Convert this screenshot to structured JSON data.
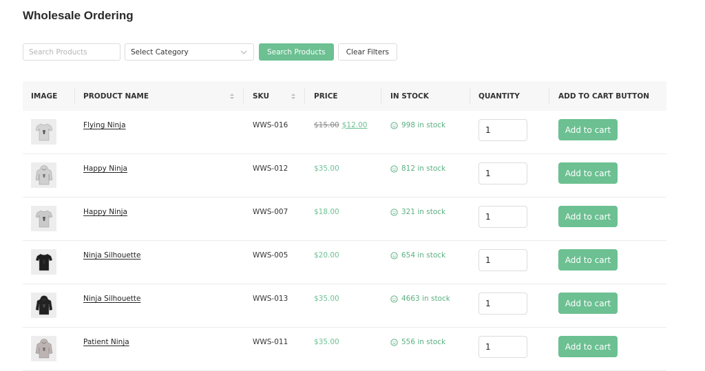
{
  "page": {
    "title": "Wholesale Ordering"
  },
  "filters": {
    "search_placeholder": "Search Products",
    "category_selected": "Select Category",
    "search_button": "Search Products",
    "clear_button": "Clear Filters"
  },
  "table": {
    "headers": {
      "image": "IMAGE",
      "product_name": "PRODUCT NAME",
      "sku": "SKU",
      "price": "PRICE",
      "in_stock": "IN STOCK",
      "quantity": "QUANTITY",
      "add_to_cart": "ADD TO CART BUTTON"
    },
    "rows": [
      {
        "name": "Flying Ninja",
        "sku": "WWS-016",
        "price_old": "$15.00",
        "price": "$12.00",
        "stock": "998 in stock",
        "qty": "1",
        "button": "Add to cart",
        "image_icon": "tshirt-icon",
        "shirt_color": "#d4d4d4"
      },
      {
        "name": "Happy Ninja",
        "sku": "WWS-012",
        "price_old": "",
        "price": "$35.00",
        "stock": "812 in stock",
        "qty": "1",
        "button": "Add to cart",
        "image_icon": "hoodie-icon",
        "shirt_color": "#cfcfcf"
      },
      {
        "name": "Happy Ninja",
        "sku": "WWS-007",
        "price_old": "",
        "price": "$18.00",
        "stock": "321 in stock",
        "qty": "1",
        "button": "Add to cart",
        "image_icon": "tshirt-icon",
        "shirt_color": "#c9c9c9"
      },
      {
        "name": "Ninja Silhouette",
        "sku": "WWS-005",
        "price_old": "",
        "price": "$20.00",
        "stock": "654 in stock",
        "qty": "1",
        "button": "Add to cart",
        "image_icon": "tshirt-icon",
        "shirt_color": "#1e1e1e"
      },
      {
        "name": "Ninja Silhouette",
        "sku": "WWS-013",
        "price_old": "",
        "price": "$35.00",
        "stock": "4663 in stock",
        "qty": "1",
        "button": "Add to cart",
        "image_icon": "hoodie-icon",
        "shirt_color": "#222222"
      },
      {
        "name": "Patient Ninja",
        "sku": "WWS-011",
        "price_old": "",
        "price": "$35.00",
        "stock": "556 in stock",
        "qty": "1",
        "button": "Add to cart",
        "image_icon": "hoodie-icon",
        "shirt_color": "#bdb3b3"
      }
    ]
  },
  "colors": {
    "accent": "#6cc092",
    "stock_text": "#5aaf80",
    "header_bg": "#f7f7f7"
  }
}
